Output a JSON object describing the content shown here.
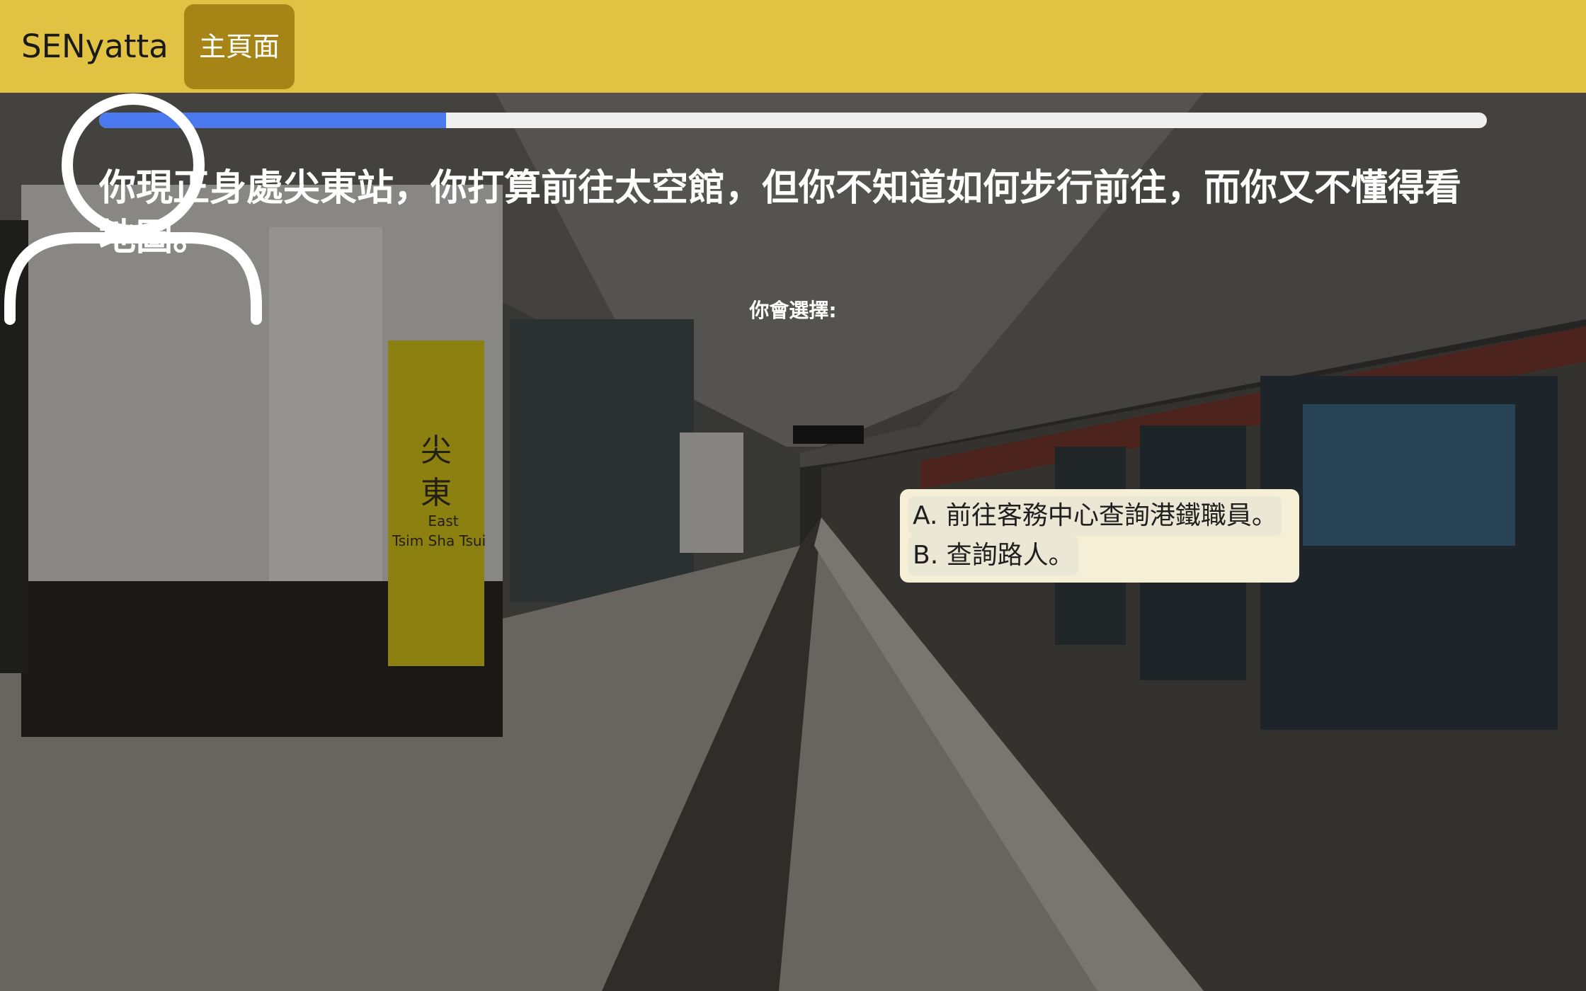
{
  "navbar": {
    "brand": "SENyatta",
    "home_label": "主頁面"
  },
  "progress": {
    "fraction": 0.25
  },
  "question": {
    "text": "你現正身處尖東站，你打算前往太空館，但你不知道如何步行前往，而你又不懂得看地圖。",
    "prompt": "你會選擇:"
  },
  "choices": [
    {
      "label": "A. 前往客務中心查詢港鐵職員。"
    },
    {
      "label": "B. 查詢路人。"
    }
  ],
  "scene": {
    "station_name_zh": "尖東",
    "station_name_en": "East Tsim Sha Tsui",
    "sign_color": "#e3cf1c",
    "icons": [
      "user-avatar-icon"
    ]
  },
  "colors": {
    "navbar": "#e2c242",
    "home_button": "#a68416",
    "progress_fill": "#4a78ee",
    "progress_track": "#efefef",
    "choice_panel": "#f5efd6"
  }
}
